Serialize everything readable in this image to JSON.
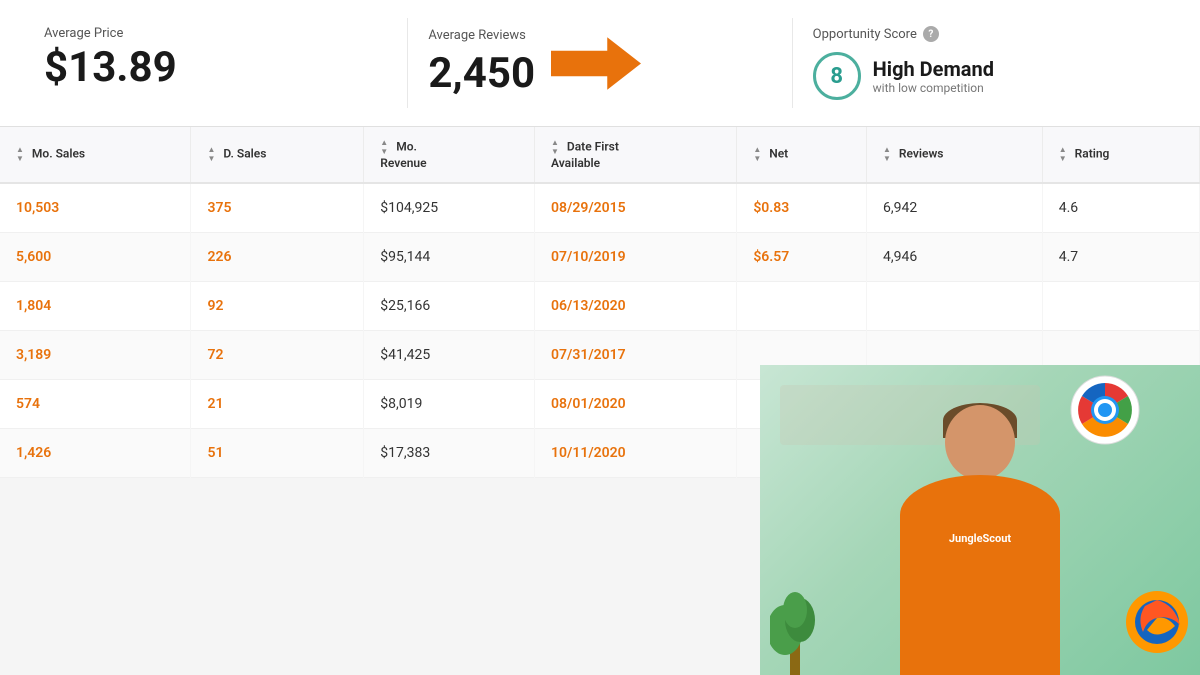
{
  "metrics": {
    "average_price": {
      "label": "Average Price",
      "value": "$13.89"
    },
    "average_reviews": {
      "label": "Average Reviews",
      "value": "2,450"
    },
    "opportunity_score": {
      "label": "Opportunity Score",
      "score": "8",
      "demand_label": "High Demand",
      "competition_label": "with low competition"
    }
  },
  "table": {
    "columns": [
      {
        "id": "mo_sales",
        "label": "Mo. Sales"
      },
      {
        "id": "d_sales",
        "label": "D. Sales"
      },
      {
        "id": "mo_revenue",
        "label": "Mo. Revenue"
      },
      {
        "id": "date_first_available",
        "label": "Date First Available"
      },
      {
        "id": "net",
        "label": "Net"
      },
      {
        "id": "reviews",
        "label": "Reviews"
      },
      {
        "id": "rating",
        "label": "Rating"
      }
    ],
    "rows": [
      {
        "mo_sales": "10,503",
        "d_sales": "375",
        "mo_revenue": "$104,925",
        "date_first_available": "08/29/2015",
        "net": "$0.83",
        "reviews": "6,942",
        "rating": "4.6"
      },
      {
        "mo_sales": "5,600",
        "d_sales": "226",
        "mo_revenue": "$95,144",
        "date_first_available": "07/10/2019",
        "net": "$6.57",
        "reviews": "4,946",
        "rating": "4.7"
      },
      {
        "mo_sales": "1,804",
        "d_sales": "92",
        "mo_revenue": "$25,166",
        "date_first_available": "06/13/2020",
        "net": "",
        "reviews": "",
        "rating": ""
      },
      {
        "mo_sales": "3,189",
        "d_sales": "72",
        "mo_revenue": "$41,425",
        "date_first_available": "07/31/2017",
        "net": "",
        "reviews": "",
        "rating": ""
      },
      {
        "mo_sales": "574",
        "d_sales": "21",
        "mo_revenue": "$8,019",
        "date_first_available": "08/01/2020",
        "net": "",
        "reviews": "",
        "rating": ""
      },
      {
        "mo_sales": "1,426",
        "d_sales": "51",
        "mo_revenue": "$17,383",
        "date_first_available": "10/11/2020",
        "net": "",
        "reviews": "",
        "rating": ""
      }
    ]
  },
  "overlay": {
    "shirt_text": "JungleScout"
  }
}
